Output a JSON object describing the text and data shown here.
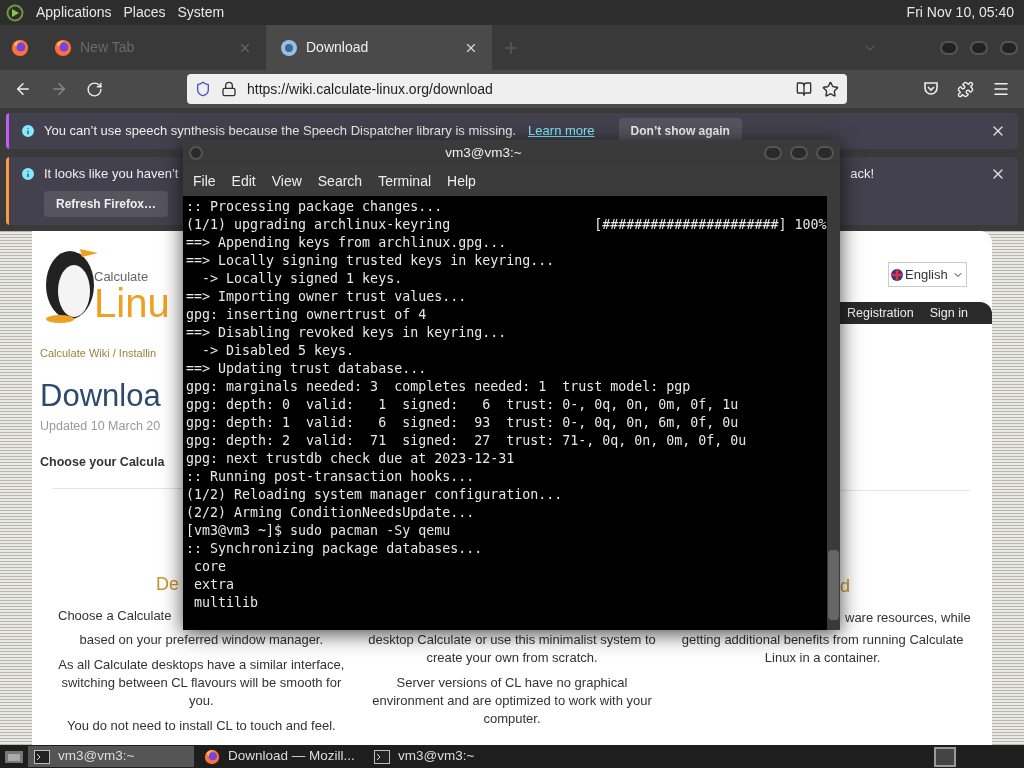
{
  "top_panel": {
    "menus": [
      "Applications",
      "Places",
      "System"
    ],
    "clock": "Fri Nov 10, 05:40"
  },
  "browser": {
    "tabs": [
      {
        "label": "New Tab",
        "selected": false
      },
      {
        "label": "Download",
        "selected": true
      }
    ],
    "url": "https://wiki.calculate-linux.org/download",
    "notifications": [
      {
        "kind": "inline",
        "text": "You can’t use speech synthesis because the Speech Dispatcher library is missing.",
        "link": "Learn more",
        "button": "Don’t show again"
      },
      {
        "kind": "below",
        "text": "It looks like you haven’t",
        "text_end": "ack!",
        "button": "Refresh Firefox…"
      }
    ]
  },
  "page": {
    "logo": {
      "top": "Calculate",
      "main": "Linu"
    },
    "breadcrumb": "Calculate Wiki / Installin",
    "title": "Downloa",
    "updated": "Updated 10 March 20",
    "intro": "Choose your Calcula",
    "language": "English",
    "nav": [
      "Registration",
      "Sign in"
    ],
    "left_heading": "De",
    "left_fragment": "Choose a Calculate",
    "right_heading": "d",
    "right_fragment": "ware resources, while",
    "columns": [
      {
        "paragraphs": [
          "based on your preferred window manager.",
          "As all Calculate desktops have a similar interface, switching between CL flavours will be smooth for you.",
          "You do not need to install CL to touch and feel."
        ]
      },
      {
        "paragraphs": [
          "desktop Calculate or use this minimalist system to create your own from scratch.",
          "Server versions of CL have no graphical environment and are optimized to work with your computer."
        ]
      },
      {
        "paragraphs": [
          "getting additional benefits from running Calculate Linux in a container."
        ]
      }
    ]
  },
  "terminal": {
    "title": "vm3@vm3:~",
    "menus": [
      "File",
      "Edit",
      "View",
      "Search",
      "Terminal",
      "Help"
    ],
    "lines": [
      ":: Processing package changes...",
      "(1/1) upgrading archlinux-keyring                  [######################] 100%",
      "==> Appending keys from archlinux.gpg...",
      "==> Locally signing trusted keys in keyring...",
      "  -> Locally signed 1 keys.",
      "==> Importing owner trust values...",
      "gpg: inserting ownertrust of 4",
      "==> Disabling revoked keys in keyring...",
      "  -> Disabled 5 keys.",
      "==> Updating trust database...",
      "gpg: marginals needed: 3  completes needed: 1  trust model: pgp",
      "gpg: depth: 0  valid:   1  signed:   6  trust: 0-, 0q, 0n, 0m, 0f, 1u",
      "gpg: depth: 1  valid:   6  signed:  93  trust: 0-, 0q, 0n, 6m, 0f, 0u",
      "gpg: depth: 2  valid:  71  signed:  27  trust: 71-, 0q, 0n, 0m, 0f, 0u",
      "gpg: next trustdb check due at 2023-12-31",
      ":: Running post-transaction hooks...",
      "(1/2) Reloading system manager configuration...",
      "(2/2) Arming ConditionNeedsUpdate...",
      "[vm3@vm3 ~]$ sudo pacman -Sy qemu",
      ":: Synchronizing package databases...",
      " core",
      " extra",
      " multilib"
    ]
  },
  "taskbar": {
    "items": [
      {
        "kind": "terminal",
        "label": "vm3@vm3:~",
        "selected": true
      },
      {
        "kind": "browser",
        "label": "Download — Mozill...",
        "selected": false
      },
      {
        "kind": "terminal",
        "label": "vm3@vm3:~",
        "selected": false
      }
    ]
  }
}
